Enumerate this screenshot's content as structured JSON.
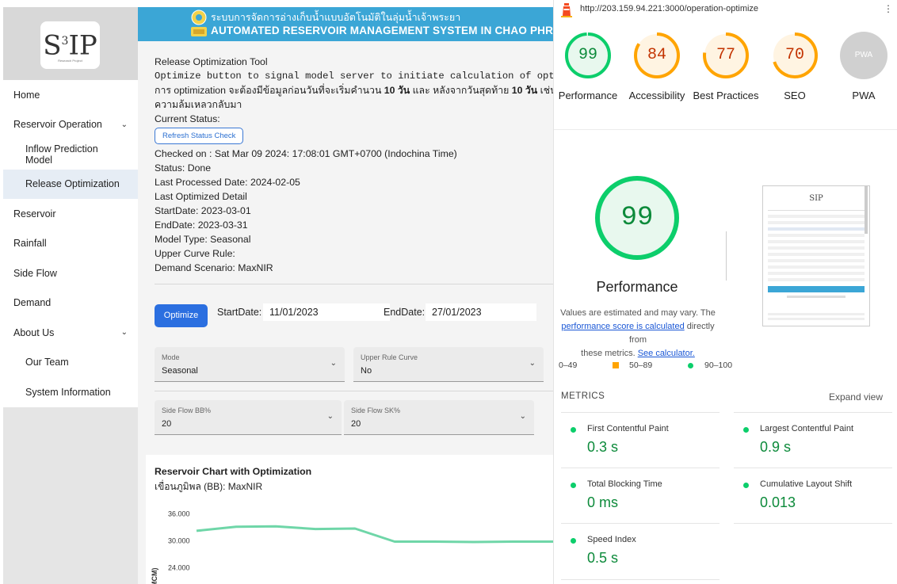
{
  "app": {
    "logo_text": "S",
    "logo_sup": "3",
    "logo_tail": "IP",
    "logo_sub": "Research Project",
    "banner_th": "ระบบการจัดการอ่างเก็บน้ำแบบอัตโนมัติในลุ่มน้ำเจ้าพระยา",
    "banner_en": "AUTOMATED RESERVOIR MANAGEMENT SYSTEM IN CHAO PHRAYA RIVER B"
  },
  "sidebar": {
    "items": [
      {
        "label": "Home"
      },
      {
        "label": "Reservoir Operation",
        "chevron": "⌄"
      },
      {
        "label": "Inflow Prediction Model"
      },
      {
        "label": "Release Optimization"
      },
      {
        "label": "Reservoir"
      },
      {
        "label": "Rainfall"
      },
      {
        "label": "Side Flow"
      },
      {
        "label": "Demand"
      },
      {
        "label": "About Us",
        "chevron": "⌄"
      },
      {
        "label": "Our Team"
      },
      {
        "label": "System Information"
      }
    ]
  },
  "main": {
    "tool_title": "Release Optimization Tool",
    "tool_desc": "Optimize button to signal model server to initiate calculation of optimization",
    "thai_note_1": "การ optimization จะต้องมีข้อมูลก่อนวันที่จะเริ่มคำนวน",
    "thai_bold_1": "10 วัน",
    "thai_note_2": "และ หลังจากวันสุดท้าย",
    "thai_bold_2": "10 วัน",
    "thai_note_3": "เช่นกัน มิฉะ",
    "thai_note_4": "ความล้มเหลวกลับมา",
    "current_status": "Current Status:",
    "refresh_label": "Refresh Status Check",
    "checked_on": "Checked on : Sat Mar 09 2024: 17:08:01 GMT+0700 (Indochina Time)",
    "status": "Status: Done",
    "last_processed": "Last Processed Date: 2024-02-05",
    "last_optimized": "Last Optimized Detail",
    "start_date": "StartDate: 2023-03-01",
    "end_date": "EndDate: 2023-03-31",
    "model_type": "Model Type: Seasonal",
    "upper_curve": "Upper Curve Rule:",
    "demand_scenario": "Demand Scenario: MaxNIR",
    "optimize_label": "Optimize",
    "start_label": "StartDate:",
    "start_value": "11/01/2023",
    "end_label": "EndDate:",
    "end_value": "27/01/2023",
    "mode_label": "Mode",
    "mode_value": "Seasonal",
    "upper_label": "Upper Rule Curve",
    "upper_value": "No",
    "bb_label": "Side Flow BB%",
    "bb_value": "20",
    "sk_label": "Side Flow SK%",
    "sk_value": "20",
    "chart_title": "Reservoir Chart with Optimization",
    "chart_sub": "เขื่อนภูมิพล (BB): MaxNIR"
  },
  "chart_data": {
    "type": "line",
    "title": "Reservoir Chart with Optimization",
    "ylabel": "MCM)",
    "y_ticks": [
      "36.000",
      "30.000",
      "24.000"
    ],
    "ylim": [
      20000,
      38000
    ],
    "series": [
      {
        "color": "#6fd6a8",
        "values": [
          32200,
          33100,
          33200,
          32600,
          32700,
          29800,
          29800,
          29700,
          29800,
          29800
        ]
      }
    ]
  },
  "lighthouse": {
    "url": "http://203.159.94.221:3000/operation-optimize",
    "kebab": "⋮",
    "scores": [
      {
        "value": "99",
        "label": "Performance",
        "color": "#0cce6b",
        "text": "#0c8a3a",
        "frac": 0.99
      },
      {
        "value": "84",
        "label": "Accessibility",
        "color": "#ffa400",
        "text": "#c33300",
        "frac": 0.84
      },
      {
        "value": "77",
        "label": "Best Practices",
        "color": "#ffa400",
        "text": "#c33300",
        "frac": 0.77
      },
      {
        "value": "70",
        "label": "SEO",
        "color": "#ffa400",
        "text": "#c33300",
        "frac": 0.7
      },
      {
        "value": "PWA",
        "label": "PWA",
        "color": "#d0d0d0",
        "text": "#ffffff",
        "frac": 1
      }
    ],
    "big_score": "99",
    "big_title": "Performance",
    "estim_1": "Values are estimated and may vary. The",
    "estim_link": "performance score is calculated",
    "estim_2": "directly from",
    "estim_3": "these metrics.",
    "estim_link2": "See calculator.",
    "legend": {
      "bad": "0–49",
      "avg": "50–89",
      "good": "90–100"
    },
    "metrics_header": "METRICS",
    "expand_label": "Expand view",
    "metrics": [
      {
        "name": "First Contentful Paint",
        "value": "0.3 s"
      },
      {
        "name": "Largest Contentful Paint",
        "value": "0.9 s"
      },
      {
        "name": "Total Blocking Time",
        "value": "0 ms"
      },
      {
        "name": "Cumulative Layout Shift",
        "value": "0.013"
      },
      {
        "name": "Speed Index",
        "value": "0.5 s"
      }
    ]
  }
}
